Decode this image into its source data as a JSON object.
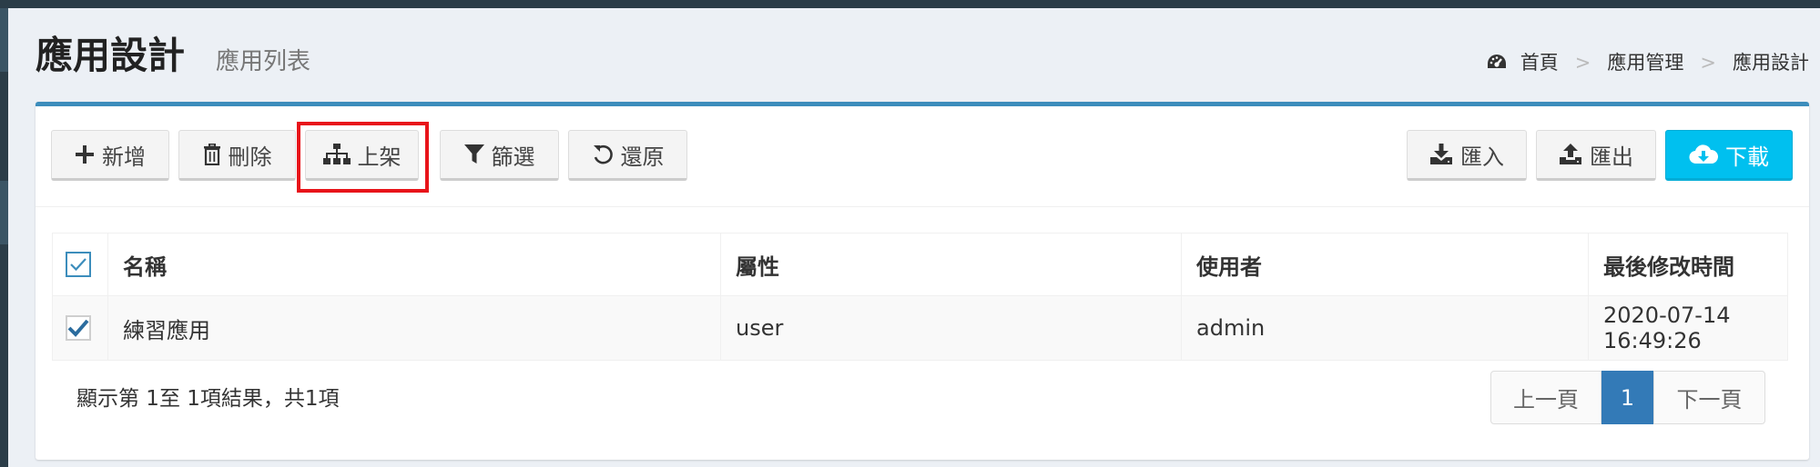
{
  "header": {
    "title": "應用設計",
    "subtitle": "應用列表"
  },
  "breadcrumb": {
    "items": [
      "首頁",
      "應用管理",
      "應用設計"
    ],
    "separator": ">"
  },
  "toolbar": {
    "add_label": "新增",
    "delete_label": "刪除",
    "publish_label": "上架",
    "filter_label": "篩選",
    "restore_label": "還原",
    "import_label": "匯入",
    "export_label": "匯出",
    "download_label": "下載"
  },
  "table": {
    "columns": [
      "名稱",
      "屬性",
      "使用者",
      "最後修改時間"
    ],
    "rows": [
      {
        "name": "練習應用",
        "attribute": "user",
        "user": "admin",
        "modified": "2020-07-14 16:49:26"
      }
    ]
  },
  "footer": {
    "info": "顯示第 1至 1項結果，共1項",
    "prev_label": "上一頁",
    "current_page": "1",
    "next_label": "下一頁"
  },
  "colors": {
    "accent": "#3c8dbc",
    "info_button": "#00c0ef",
    "highlight": "#e8141a",
    "page_active": "#337ab7"
  },
  "icons": {
    "add": "plus-icon",
    "delete": "trash-icon",
    "publish": "sitemap-icon",
    "filter": "filter-icon",
    "restore": "undo-icon",
    "import": "download-icon",
    "export": "upload-icon",
    "download": "cloud-download-icon",
    "home": "dashboard-icon"
  }
}
